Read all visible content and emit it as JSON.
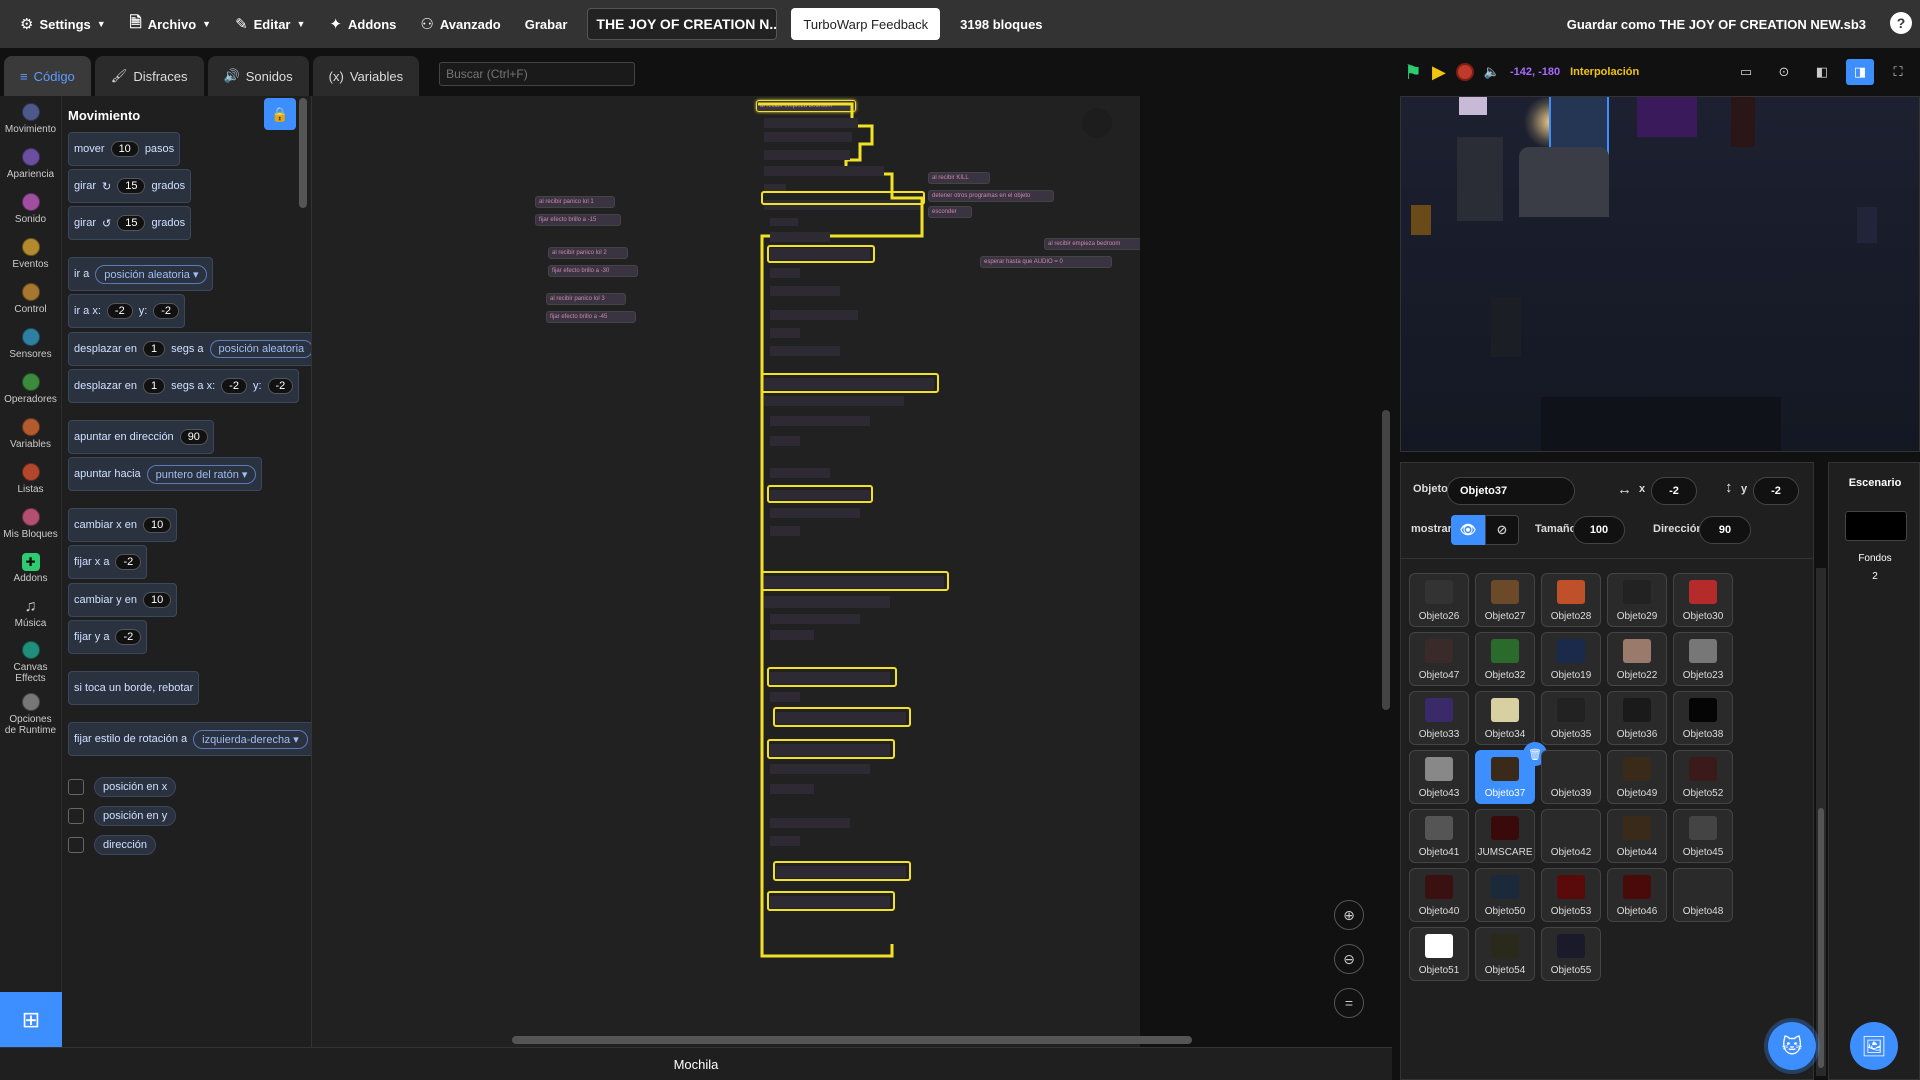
{
  "menubar": {
    "settings": "Settings",
    "archivo": "Archivo",
    "editar": "Editar",
    "addons": "Addons",
    "avanzado": "Avanzado",
    "grabar": "Grabar",
    "project_title": "THE JOY OF CREATION N...",
    "feedback": "TurboWarp Feedback",
    "block_count": "3198 bloques",
    "save_as": "Guardar como THE JOY OF CREATION NEW.sb3",
    "help": "?"
  },
  "tabs": [
    {
      "label": "Código"
    },
    {
      "label": "Disfraces"
    },
    {
      "label": "Sonidos"
    },
    {
      "label": "Variables"
    }
  ],
  "search": {
    "placeholder": "Buscar (Ctrl+F)"
  },
  "categories": [
    {
      "label": "Movimiento",
      "color": "#4c5a8a"
    },
    {
      "label": "Apariencia",
      "color": "#6a4fa0"
    },
    {
      "label": "Sonido",
      "color": "#a04fa0"
    },
    {
      "label": "Eventos",
      "color": "#b38a2e"
    },
    {
      "label": "Control",
      "color": "#a6772e"
    },
    {
      "label": "Sensores",
      "color": "#2e7fa0"
    },
    {
      "label": "Operadores",
      "color": "#3c8a3c"
    },
    {
      "label": "Variables",
      "color": "#b35a2e"
    },
    {
      "label": "Listas",
      "color": "#b3472e"
    },
    {
      "label": "Mis Bloques",
      "color": "#b34f70"
    },
    {
      "label": "Addons",
      "color": "#2ecc71"
    },
    {
      "label": "Música",
      "color": "#2ecc71"
    },
    {
      "label": "Canvas Effects",
      "color": "#1f8f7a"
    },
    {
      "label": "Opciones de Runtime",
      "color": "#777777"
    }
  ],
  "palette": {
    "title": "Movimiento",
    "blocks": {
      "mover": "mover",
      "mover_val": "10",
      "pasos": "pasos",
      "girar": "girar",
      "girar_r_val": "15",
      "grados": "grados",
      "girar_l_val": "15",
      "ir_a": "ir a",
      "posicion_aleatoria": "posición aleatoria",
      "ir_a_x": "ir a x:",
      "x_val": "-2",
      "y_label": "y:",
      "y_val": "-2",
      "desplazar_en": "desplazar en",
      "desp_val": "1",
      "segs_a": "segs a",
      "segs_a_x": "segs a x:",
      "desp2_val": "1",
      "desp2_x": "-2",
      "desp2_y": "-2",
      "apuntar_dir": "apuntar en dirección",
      "dir_val": "90",
      "apuntar_hacia": "apuntar hacia",
      "puntero": "puntero del ratón",
      "cambiar_x": "cambiar x en",
      "cambiar_x_val": "10",
      "fijar_x": "fijar x a",
      "fijar_x_val": "-2",
      "cambiar_y": "cambiar y en",
      "cambiar_y_val": "10",
      "fijar_y": "fijar y a",
      "fijar_y_val": "-2",
      "rebotar": "si toca un borde, rebotar",
      "estilo_rot": "fijar estilo de rotación a",
      "izq_der": "izquierda-derecha",
      "pos_x": "posición en x",
      "pos_y": "posición en y",
      "direccion": "dirección"
    }
  },
  "scripts": {
    "s1_hat": "al recibir  panico lol 1",
    "s1_b1": "fijar efecto  brillo  a  -15",
    "s2_hat": "al recibir  panico lol 2",
    "s2_b1": "fijar efecto  brillo  a  -30",
    "s3_hat": "al recibir  panico lol 3",
    "s3_b1": "fijar efecto  brillo  a  -45",
    "s4_hat": "al recibir  KILL",
    "s4_b1": "detener  otros programas en el objeto",
    "s4_b2": "esconder",
    "s5_hat": "al recibir  empieza bedroom",
    "s5_b1": "esperar hasta que  AUDIO  =  0",
    "main_hat": "al recibir  empieza bedroom"
  },
  "backpack": "Mochila",
  "stage_header": {
    "coords": "-142, -180",
    "interp": "Interpolación"
  },
  "sprite_info": {
    "objeto_label": "Objeto",
    "objeto_name": "Objeto37",
    "x_label": "x",
    "x_val": "-2",
    "y_label": "y",
    "y_val": "-2",
    "mostrar": "mostrar",
    "tamano_label": "Tamaño",
    "tamano_val": "100",
    "direccion_label": "Dirección",
    "direccion_val": "90"
  },
  "sprites": [
    {
      "name": "Objeto26",
      "color": "#333333"
    },
    {
      "name": "Objeto27",
      "color": "#6b4a2a"
    },
    {
      "name": "Objeto28",
      "color": "#c0502a"
    },
    {
      "name": "Objeto29",
      "color": "#222222"
    },
    {
      "name": "Objeto30",
      "color": "#b52a2a"
    },
    {
      "name": "Objeto47",
      "color": "#3a2a2a"
    },
    {
      "name": "Objeto32",
      "color": "#2a6a2a"
    },
    {
      "name": "Objeto19",
      "color": "#1a2a4a"
    },
    {
      "name": "Objeto22",
      "color": "#9a7a6a"
    },
    {
      "name": "Objeto23",
      "color": "#777777"
    },
    {
      "name": "Objeto33",
      "color": "#3a2a6a"
    },
    {
      "name": "Objeto34",
      "color": "#d8d0a0"
    },
    {
      "name": "Objeto35",
      "color": "#222222"
    },
    {
      "name": "Objeto36",
      "color": "#1a1a1a"
    },
    {
      "name": "Objeto38",
      "color": "#050505"
    },
    {
      "name": "Objeto43",
      "color": "#888888"
    },
    {
      "name": "Objeto37",
      "color": "#3a2a1a",
      "selected": true
    },
    {
      "name": "Objeto39",
      "color": "#2a2a2a"
    },
    {
      "name": "Objeto49",
      "color": "#3a2a1a"
    },
    {
      "name": "Objeto52",
      "color": "#3a1a1a"
    },
    {
      "name": "Objeto41",
      "color": "#555555"
    },
    {
      "name": "JUMSCARE",
      "color": "#3a0a0a"
    },
    {
      "name": "Objeto42",
      "color": "#2a2a2a"
    },
    {
      "name": "Objeto44",
      "color": "#3a2a1a"
    },
    {
      "name": "Objeto45",
      "color": "#444444"
    },
    {
      "name": "Objeto40",
      "color": "#3a1010"
    },
    {
      "name": "Objeto50",
      "color": "#1a2a3a"
    },
    {
      "name": "Objeto53",
      "color": "#5a0a0a"
    },
    {
      "name": "Objeto46",
      "color": "#4a0a0a"
    },
    {
      "name": "Objeto48",
      "color": "#2a2a2a"
    },
    {
      "name": "Objeto51",
      "color": "#ffffff"
    },
    {
      "name": "Objeto54",
      "color": "#2a2a1a"
    },
    {
      "name": "Objeto55",
      "color": "#1a1a2a"
    }
  ],
  "backdrop": {
    "title": "Escenario",
    "label": "Fondos",
    "count": "2"
  },
  "colors": {
    "accent": "#3d8eff",
    "highlight": "#f2e227",
    "flag": "#2ecc71"
  }
}
